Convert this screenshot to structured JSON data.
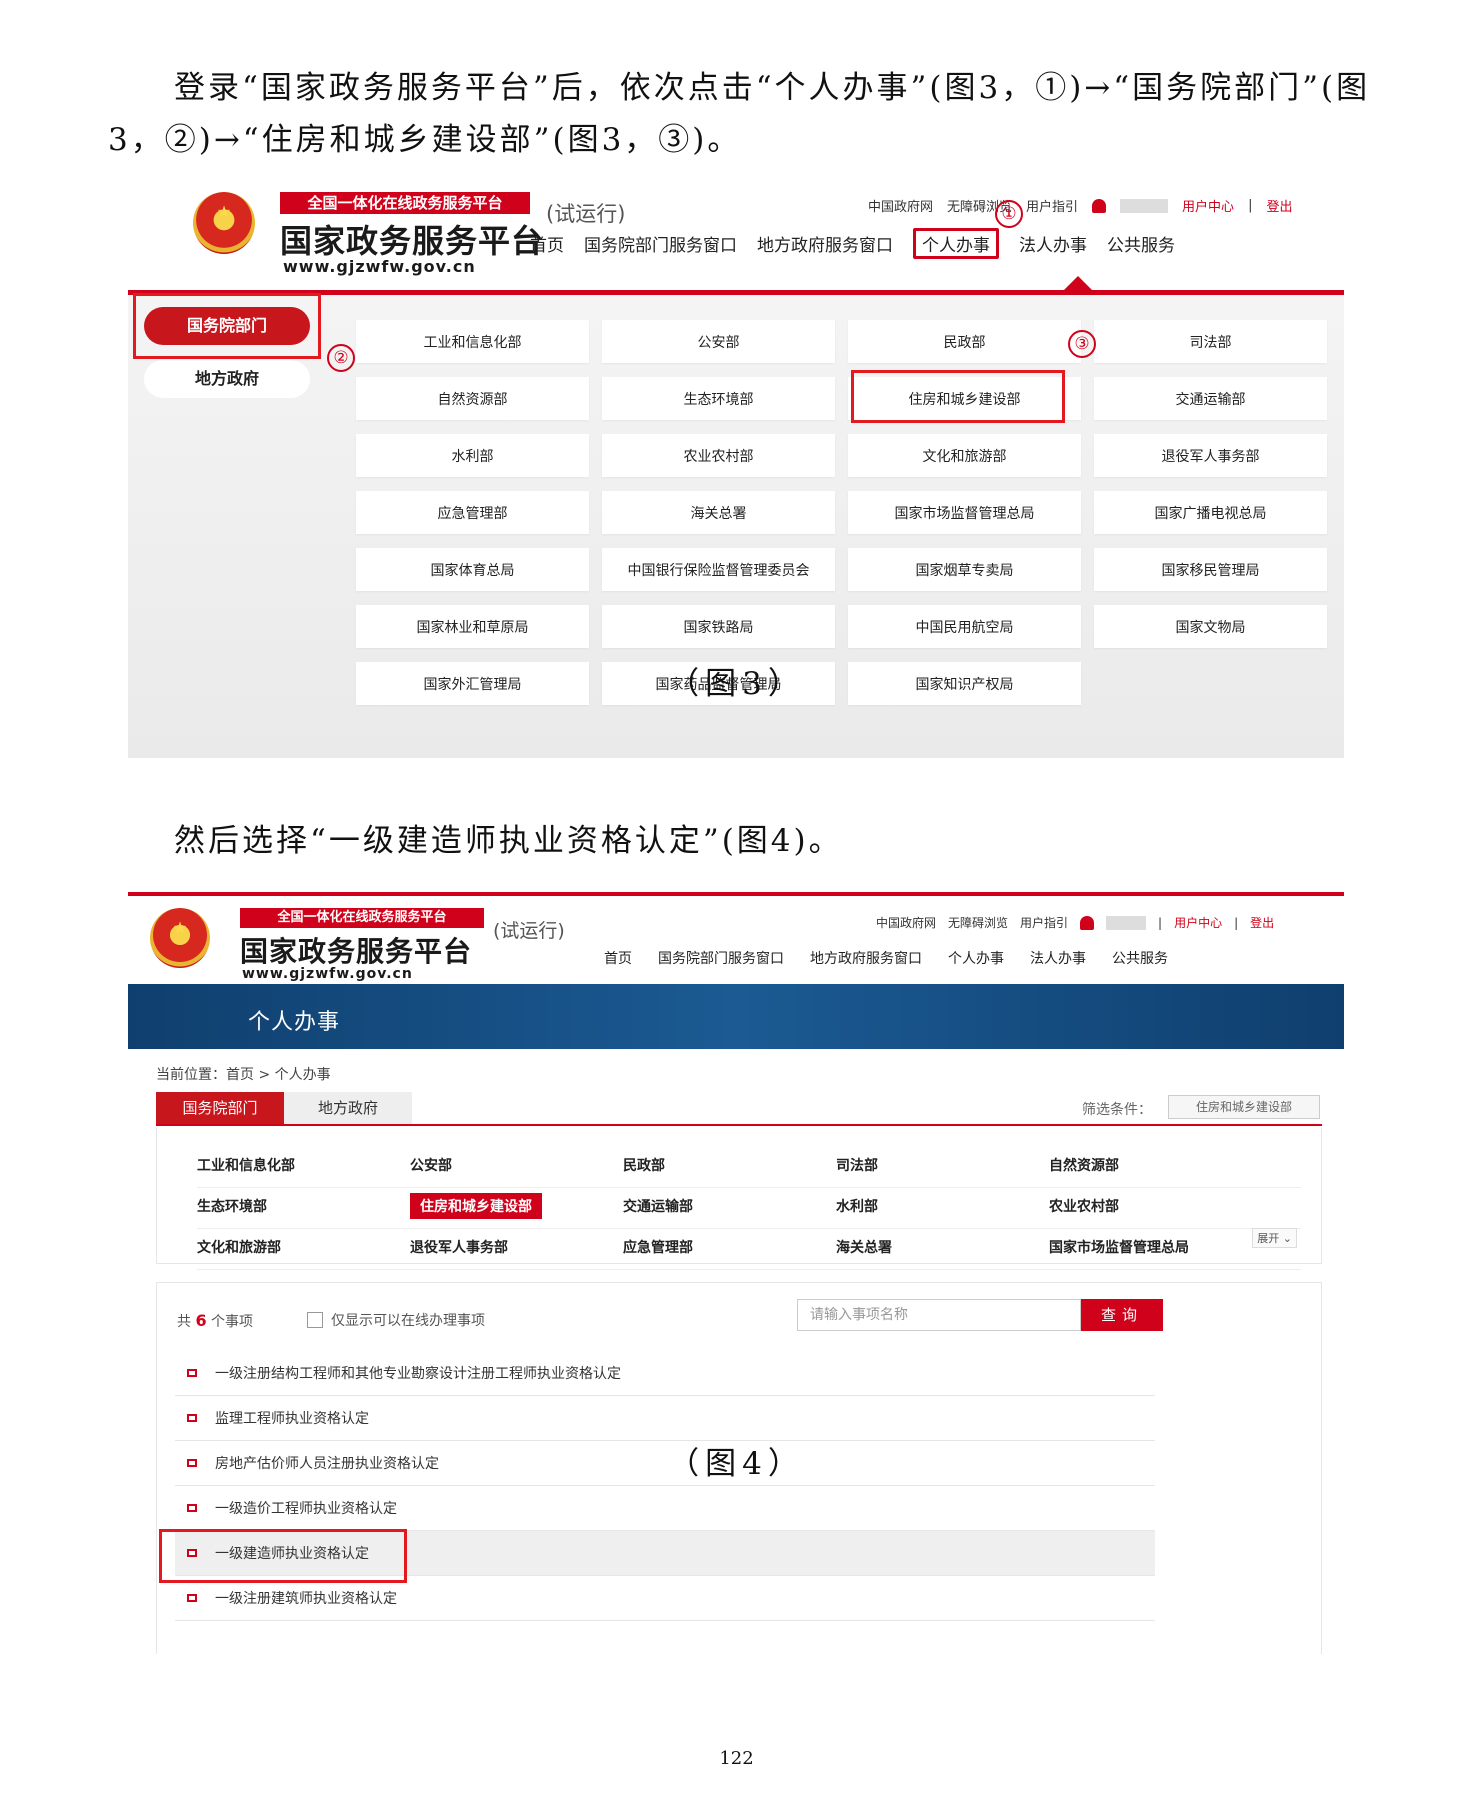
{
  "intro_paragraph": "登录“国家政务服务平台”后，依次点击“个人办事”(图3，①)→“国务院部门”(图3，②)→“住房和城乡建设部”(图3，③)。",
  "caption3": "（图3）",
  "paragraph2": "然后选择“一级建造师执业资格认定”(图4)。",
  "caption4": "（图4）",
  "page_number": "122",
  "site": {
    "tagline": "全国一体化在线政务服务平台",
    "name": "国家政务服务平台",
    "url": "www.gjzwfw.gov.cn",
    "trial": "(试运行)",
    "top_links": {
      "gov": "中国政府网",
      "accessible": "无障碍浏览",
      "guide": "用户指引",
      "user_center": "用户中心",
      "divider": "|",
      "logout": "登出"
    },
    "nav": [
      "首页",
      "国务院部门服务窗口",
      "地方政府服务窗口",
      "个人办事",
      "法人办事",
      "公共服务"
    ]
  },
  "annotations": {
    "one": "①",
    "two": "②",
    "three": "③"
  },
  "fig3": {
    "side": {
      "active": "国务院部门",
      "other": "地方政府"
    },
    "departments": [
      "工业和信息化部",
      "公安部",
      "民政部",
      "司法部",
      "自然资源部",
      "生态环境部",
      "住房和城乡建设部",
      "交通运输部",
      "水利部",
      "农业农村部",
      "文化和旅游部",
      "退役军人事务部",
      "应急管理部",
      "海关总署",
      "国家市场监督管理总局",
      "国家广播电视总局",
      "国家体育总局",
      "中国银行保险监督管理委员会",
      "国家烟草专卖局",
      "国家移民管理局",
      "国家林业和草原局",
      "国家铁路局",
      "中国民用航空局",
      "国家文物局",
      "国家外汇管理局",
      "国家药品监督管理局",
      "国家知识产权局"
    ]
  },
  "fig4": {
    "band_title": "个人办事",
    "breadcrumb": "当前位置：首页 > 个人办事",
    "tabs": {
      "active": "国务院部门",
      "other": "地方政府"
    },
    "filter_label": "筛选条件：",
    "filter_value": "住房和城乡建设部",
    "dept_rows": [
      [
        "工业和信息化部",
        "公安部",
        "民政部",
        "司法部",
        "自然资源部"
      ],
      [
        "生态环境部",
        "住房和城乡建设部",
        "交通运输部",
        "水利部",
        "农业农村部"
      ],
      [
        "文化和旅游部",
        "退役军人事务部",
        "应急管理部",
        "海关总署",
        "国家市场监督管理总局"
      ]
    ],
    "expand": "展开",
    "count_prefix": "共",
    "count": "6",
    "count_suffix": "个事项",
    "online_only": "仅显示可以在线办理事项",
    "search_placeholder": "请输入事项名称",
    "search_button": "查询",
    "items": [
      "一级注册结构工程师和其他专业勘察设计注册工程师执业资格认定",
      "监理工程师执业资格认定",
      "房地产估价师人员注册执业资格认定",
      "一级造价工程师执业资格认定",
      "一级建造师执业资格认定",
      "一级注册建筑师执业资格认定"
    ]
  },
  "colors": {
    "brand_red": "#d0021b",
    "band_blue": "#1b5a93"
  }
}
